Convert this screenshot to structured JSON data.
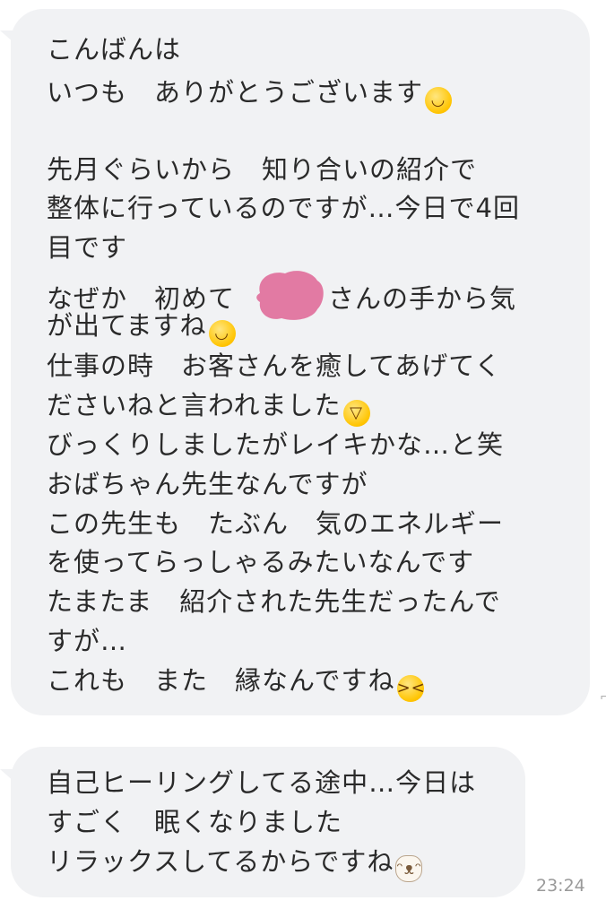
{
  "messages": [
    {
      "lines": [
        "こんばんは",
        "いつも　ありがとうございます",
        "",
        "先月ぐらいから　知り合いの紹介で",
        "整体に行っているのですが…今日で4回",
        "目です",
        "なぜか　初めて",
        "さんの手から気",
        "が出てますね",
        "仕事の時　お客さんを癒してあげてく",
        "ださいねと言われました",
        "びっくりしましたがレイキかな…と笑",
        "おばちゃん先生なんですが",
        "この先生も　たぶん　気のエネルギー",
        "を使ってらっしゃるみたいなんです",
        "たまたま　紹介された先生だったんで",
        "すが…",
        "これも　また　縁なんですね"
      ],
      "redaction_color": "#e27aa3"
    },
    {
      "lines": [
        "自己ヒーリングしてる途中…今日は",
        "すごく　眠くなりました",
        "リラックスしてるからですね"
      ],
      "timestamp": "23:24"
    }
  ],
  "emoji": {
    "smile_1": "smiling-face-emoji",
    "smile_2": "smiling-face-emoji",
    "sweat": "grinning-sweat-emoji",
    "laugh": "laughing-face-emoji",
    "cat": "cat-sticker-emoji"
  },
  "colors": {
    "bubble": "#f1f2f4",
    "text": "#2a2a2a",
    "timestamp": "#9a9a9a"
  }
}
